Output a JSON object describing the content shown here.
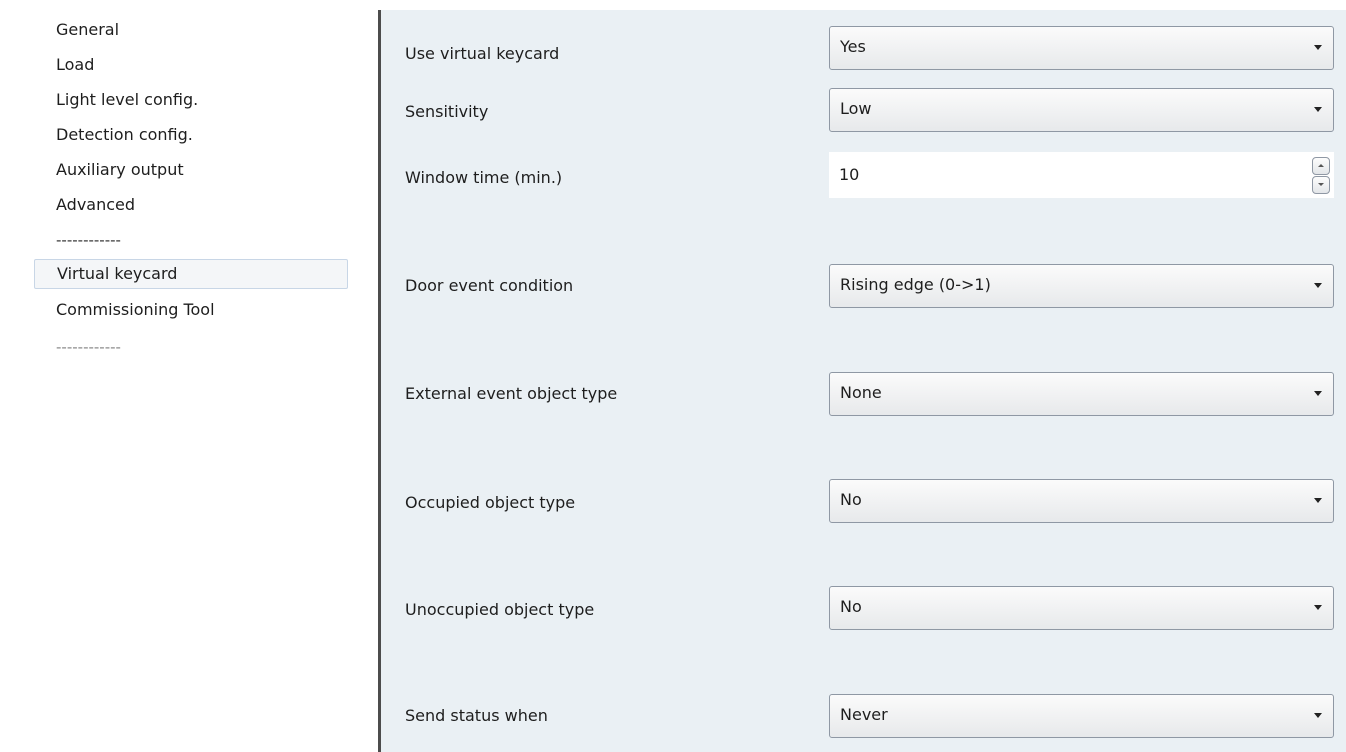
{
  "sidebar": {
    "items": [
      {
        "label": "General"
      },
      {
        "label": "Load"
      },
      {
        "label": "Light level config."
      },
      {
        "label": "Detection config."
      },
      {
        "label": "Auxiliary output"
      },
      {
        "label": "Advanced"
      },
      {
        "label": "------------"
      },
      {
        "label": "Virtual keycard",
        "selected": true
      },
      {
        "label": "Commissioning Tool"
      },
      {
        "label": "------------"
      }
    ]
  },
  "params": {
    "use_virtual_keycard": {
      "label": "Use virtual keycard",
      "value": "Yes"
    },
    "sensitivity": {
      "label": "Sensitivity",
      "value": "Low"
    },
    "window_time": {
      "label": "Window time (min.)",
      "value": "10"
    },
    "door_event_condition": {
      "label": "Door event condition",
      "value": "Rising edge (0->1)"
    },
    "external_event_object_type": {
      "label": "External event object type",
      "value": "None"
    },
    "occupied_object_type": {
      "label": "Occupied object type",
      "value": "No"
    },
    "unoccupied_object_type": {
      "label": "Unoccupied object type",
      "value": "No"
    },
    "send_status_when": {
      "label": "Send status when",
      "value": "Never"
    }
  },
  "icons": {
    "dropdown": "chevron-down-icon",
    "spin_up": "spin-up-icon",
    "spin_down": "spin-down-icon"
  },
  "colors": {
    "content_bg": "#eaf0f4",
    "divider": "#4c4c4c",
    "selected_border": "#c8d6e6"
  }
}
